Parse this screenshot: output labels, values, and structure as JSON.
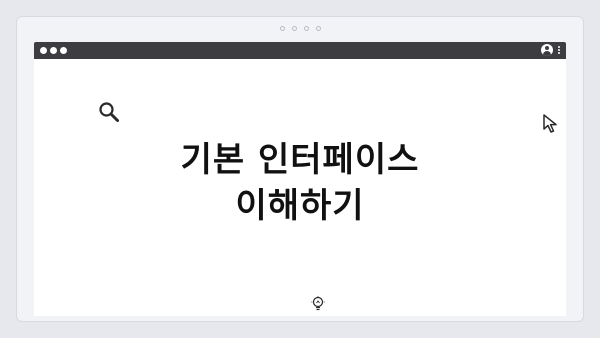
{
  "page": {
    "title_line1": "기본 인터페이스",
    "title_line2": "이해하기"
  },
  "icons": {
    "top_dots": "page-indicator-dots",
    "window_controls": "traffic-light-dots",
    "user": "user-icon",
    "menu": "kebab-menu-icon",
    "search": "search-icon",
    "cursor": "cursor-icon",
    "bulb": "lightbulb-icon"
  },
  "colors": {
    "background": "#e6e8ee",
    "browser_bar": "#3c3c41",
    "content": "#ffffff",
    "title_text": "#111111"
  }
}
